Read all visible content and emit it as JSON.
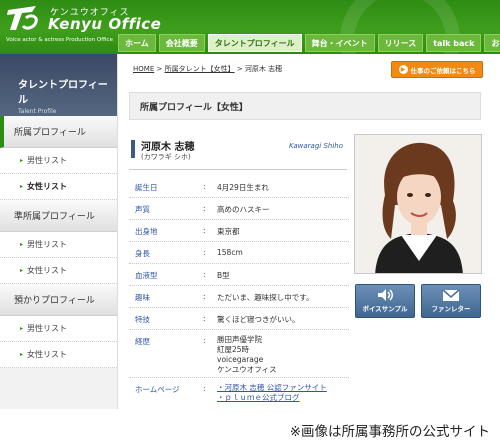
{
  "header": {
    "logo_kana": "ケンユウオフィス",
    "logo_name": "Kenyu Office",
    "logo_sub": "Voice actor & actress Production Office",
    "nav": [
      "ホーム",
      "会社概要",
      "タレントプロフィール",
      "舞台・イベント",
      "リリース",
      "talk back",
      "お問い合わせ"
    ],
    "active_nav": 2
  },
  "sidebar": {
    "title": "タレントプロフィール",
    "subtitle": "Talent Profile",
    "sections": [
      {
        "label": "所属プロフィール",
        "items": [
          "男性リスト",
          "女性リスト"
        ]
      },
      {
        "label": "準所属プロフィール",
        "items": [
          "男性リスト",
          "女性リスト"
        ]
      },
      {
        "label": "預かりプロフィール",
        "items": [
          "男性リスト",
          "女性リスト"
        ]
      }
    ]
  },
  "main": {
    "breadcrumb": {
      "home": "HOME",
      "sep": ">",
      "category": "所属タレント【女性】",
      "current": "河原木 志穂"
    },
    "mail_button": "仕事のご依頼はこちら",
    "section_title": "所属プロフィール【女性】",
    "name_jp": "河原木 志穂",
    "name_kana": "(カワラギ シホ)",
    "name_en": "Kawaragi Shiho",
    "colon": ":",
    "profile": [
      {
        "key": "誕生日",
        "value": "4月29日生まれ"
      },
      {
        "key": "声質",
        "value": "高めのハスキー"
      },
      {
        "key": "出身地",
        "value": "東京都"
      },
      {
        "key": "身長",
        "value": "158cm"
      },
      {
        "key": "血液型",
        "value": "B型"
      },
      {
        "key": "趣味",
        "value": "ただいま、趣味探し中です。"
      },
      {
        "key": "特技",
        "value": "驚くほど寝つきがいい。"
      }
    ],
    "career_key": "経歴",
    "career": [
      "勝田声優学院",
      "紅屋25時",
      "voicegarage",
      "ケンユウオフィス"
    ],
    "homepage_key": "ホームページ",
    "homepage_links": [
      "・河原木 志穂 公認ファンサイト",
      "・ｐｌｕｍｅ公式ブログ"
    ],
    "voice_button": "ボイスサンプル",
    "fan_button": "ファンレター"
  },
  "caption": "※画像は所属事務所の公式サイト",
  "colors": {
    "header_green": "#2e8b14",
    "link_blue": "#2f57a5",
    "orange": "#f08a14",
    "button_blue": "#4a6f98"
  }
}
